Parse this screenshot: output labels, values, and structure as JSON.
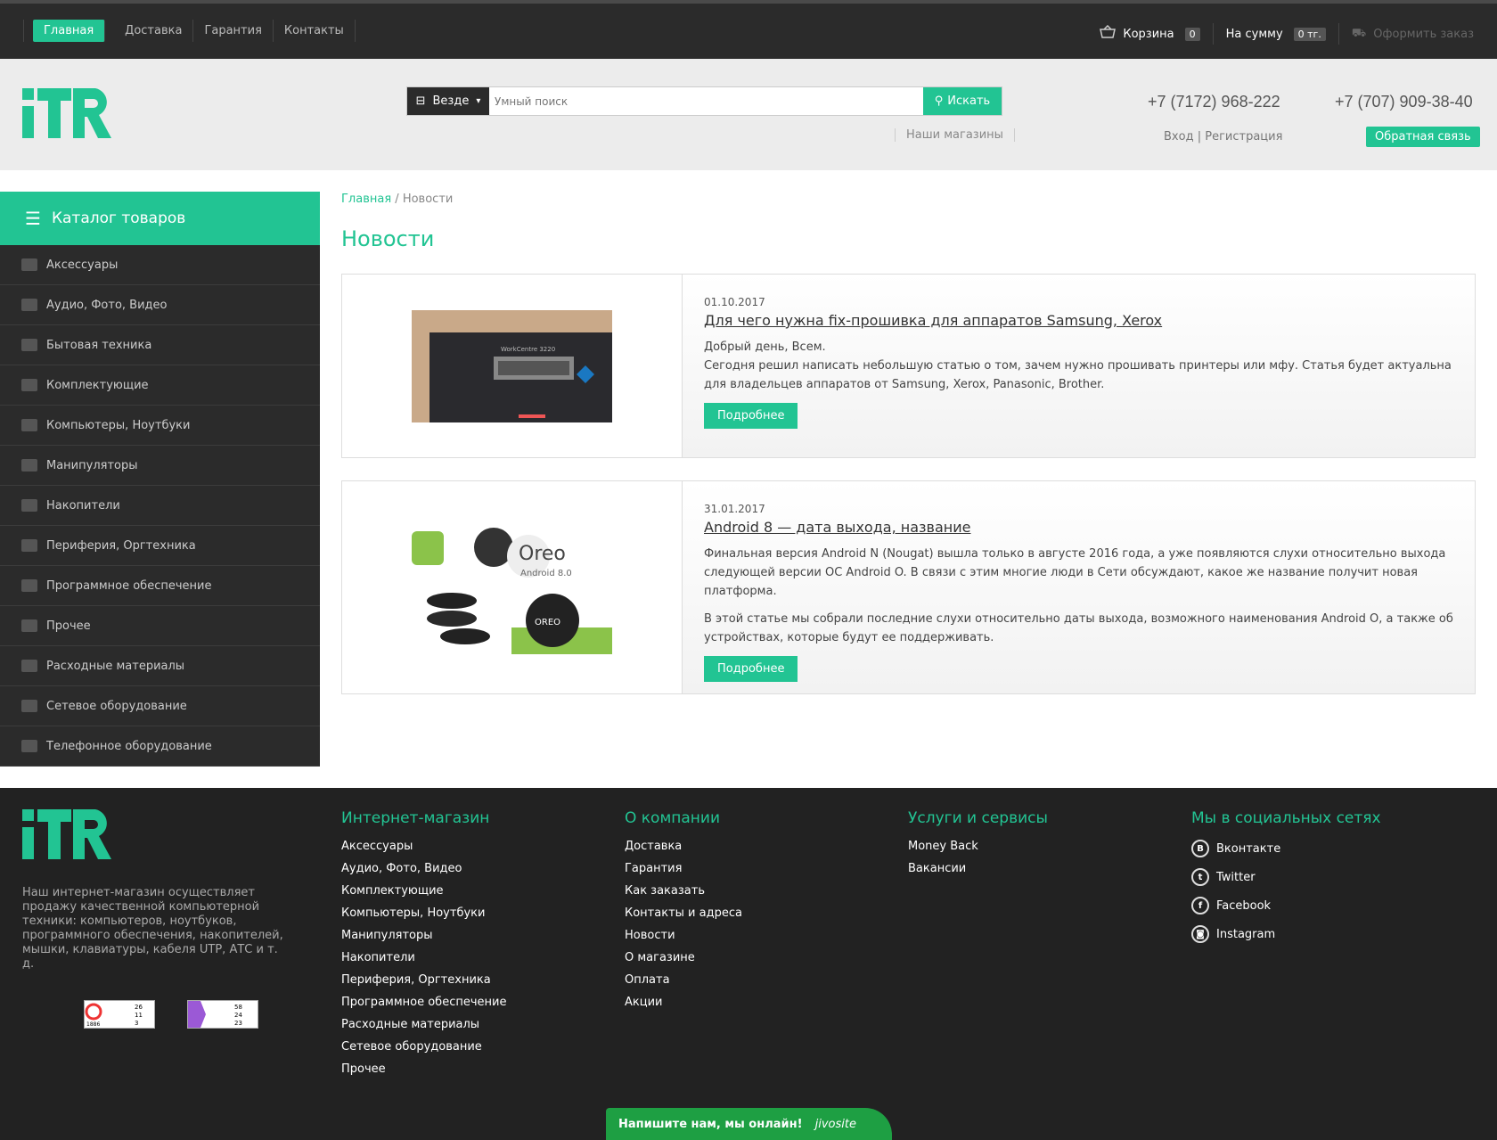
{
  "topnav": [
    "Главная",
    "Доставка",
    "Гарантия",
    "Контакты"
  ],
  "topbar": {
    "cart_label": "Корзина",
    "cart_count": "0",
    "sum_label": "На сумму",
    "sum_value": "0 тг.",
    "checkout": "Оформить заказ"
  },
  "search": {
    "scope": "Везде",
    "placeholder": "Умный поиск",
    "button": "Искать"
  },
  "stores_link": "Наши магазины",
  "phones": [
    "+7 (7172) 968-222",
    "+7 (707) 909-38-40"
  ],
  "auth": {
    "login": "Вход",
    "sep": "|",
    "register": "Регистрация"
  },
  "feedback_button": "Обратная связь",
  "catalog": {
    "title": "Каталог товаров",
    "items": [
      "Аксессуары",
      "Аудио, Фото, Видео",
      "Бытовая техника",
      "Комплектующие",
      "Компьютеры, Ноутбуки",
      "Манипуляторы",
      "Накопители",
      "Периферия, Оргтехника",
      "Программное обеспечение",
      "Прочее",
      "Расходные материалы",
      "Сетевое оборудование",
      "Телефонное оборудование"
    ]
  },
  "breadcrumb": {
    "home": "Главная",
    "sep": "/",
    "current": "Новости"
  },
  "page_title": "Новости",
  "news": [
    {
      "date": "01.10.2017",
      "title": "Для чего нужна fix-прошивка для аппаратов Samsung, Xerox",
      "paragraphs": [
        "Добрый день, Всем.\nСегодня решил написать небольшую статью о том, зачем нужно прошивать принтеры или мфу. Статья будет актуальна для владельцев аппаратов от Samsung, Xerox, Panasonic, Brother."
      ],
      "more": "Подробнее",
      "image_text": "WorkCentre 3220"
    },
    {
      "date": "31.01.2017",
      "title": "Android 8 — дата выхода, название",
      "paragraphs": [
        "Финальная версия Android N (Nougat) вышла только в августе 2016 года, а уже появляются слухи относительно выхода следующей версии ОС Android O. В связи с этим многие люди в Сети обсуждают, какое же название получит новая платформа.",
        "В этой статье мы собрали последние слухи относительно даты выхода, возможного наименования Android O, а также об устройствах, которые будут ее поддерживать."
      ],
      "more": "Подробнее",
      "image_text": [
        "Oreo",
        "Android 8.0",
        "OREO"
      ]
    }
  ],
  "footer": {
    "desc": "Наш интернет-магазин осуществляет продажу качественной компьютерной техники: компьютеров, ноутбуков, программного обеспечения, накопителей, мышки, клавиатуры, кабеля UTP, АТС и т. д.",
    "counters": [
      [
        "26",
        "11",
        "3",
        "1886"
      ],
      [
        "58",
        "24",
        "23"
      ]
    ],
    "cols": [
      {
        "title": "Интернет-магазин",
        "links": [
          "Аксессуары",
          "Аудио, Фото, Видео",
          "Комплектующие",
          "Компьютеры, Ноутбуки",
          "Манипуляторы",
          "Накопители",
          "Периферия, Оргтехника",
          "Программное обеспечение",
          "Расходные материалы",
          "Сетевое оборудование",
          "Прочее"
        ]
      },
      {
        "title": "О компании",
        "links": [
          "Доставка",
          "Гарантия",
          "Как заказать",
          "Контакты и адреса",
          "Новости",
          "О магазине",
          "Оплата",
          "Акции"
        ]
      },
      {
        "title": "Услуги и сервисы",
        "links": [
          "Money Back",
          "Вакансии"
        ]
      },
      {
        "title": "Мы в социальных сетях",
        "links": [
          "Вконтакте",
          "Twitter",
          "Facebook",
          "Instagram"
        ],
        "icons": [
          "В",
          "t",
          "f",
          "◙"
        ]
      }
    ]
  },
  "chat": {
    "text": "Напишите нам, мы онлайн!",
    "brand": "jivosite"
  },
  "colors": {
    "accent": "#22c493",
    "dark": "#2b2b2b"
  }
}
